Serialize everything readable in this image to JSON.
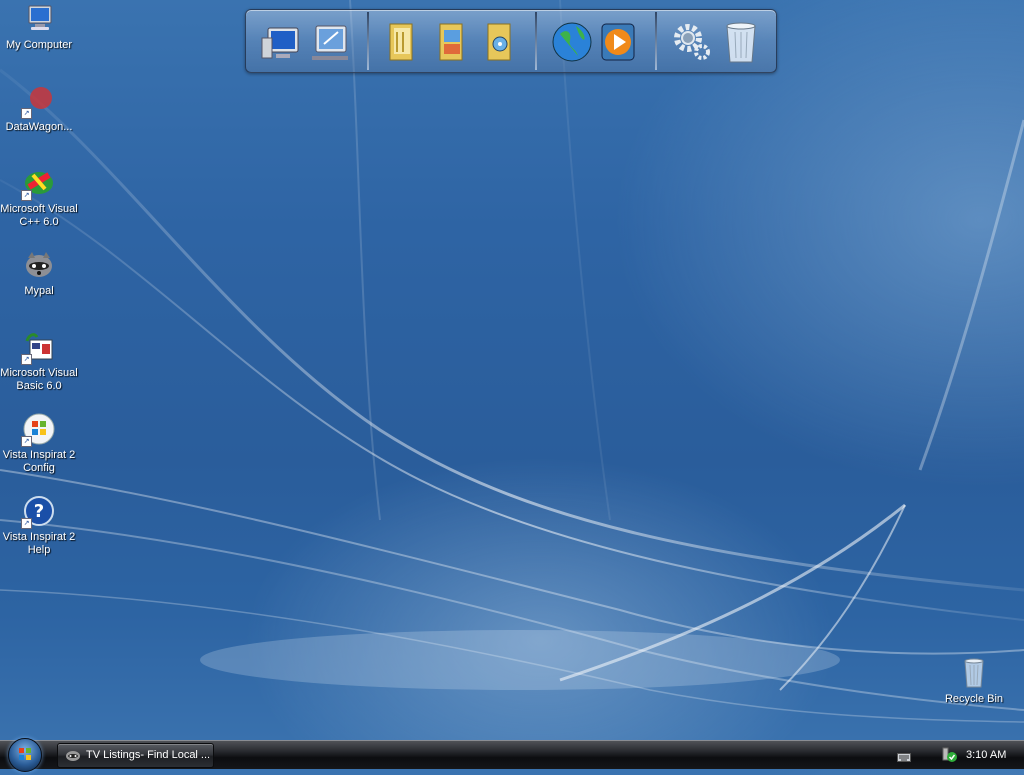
{
  "desktop": {
    "icons": [
      {
        "label": "My Computer",
        "icon": "my-computer-icon"
      },
      {
        "label": "DataWagon...",
        "icon": "datawagon-icon"
      },
      {
        "label": "Microsoft Visual C++ 6.0",
        "icon": "visual-cpp-icon"
      },
      {
        "label": "Mypal",
        "icon": "mypal-raccoon-icon"
      },
      {
        "label": "Microsoft Visual Basic 6.0",
        "icon": "visual-basic-icon"
      },
      {
        "label": "Vista Inspirat 2 Config",
        "icon": "windows-flag-icon"
      },
      {
        "label": "Vista Inspirat 2 Help",
        "icon": "help-icon"
      },
      {
        "label": "Recycle Bin",
        "icon": "recycle-bin-icon"
      }
    ]
  },
  "dock": {
    "items": [
      "computer-icon",
      "network-icon",
      "documents-folder-icon",
      "pictures-folder-icon",
      "music-folder-icon",
      "internet-globe-icon",
      "media-player-icon",
      "settings-gears-icon",
      "trash-icon"
    ]
  },
  "taskbar": {
    "task_label": "TV Listings- Find Local ...",
    "clock": "3:10 AM",
    "tray": [
      "keyboard-icon",
      "security-shield-icon"
    ]
  }
}
